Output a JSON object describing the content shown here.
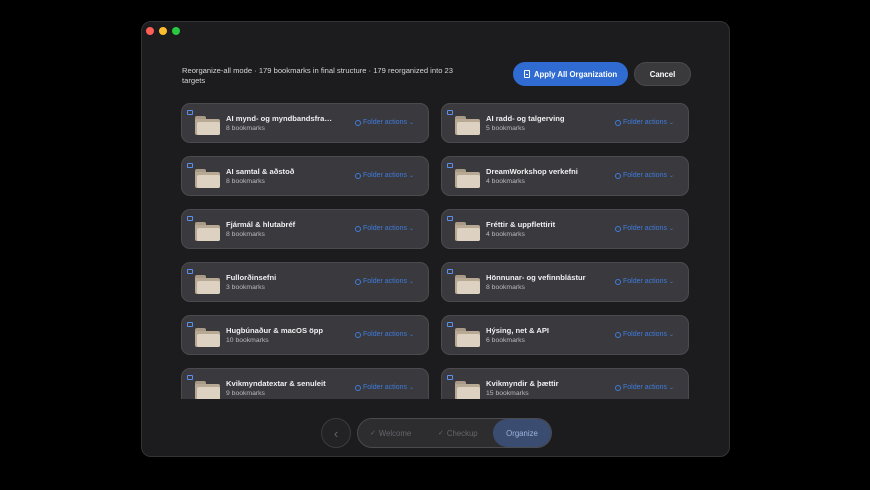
{
  "window": {
    "summary": "Reorganize-all mode · 179 bookmarks in final structure · 179 reorganized into 23 targets",
    "apply_label": "Apply All Organization",
    "cancel_label": "Cancel",
    "accent_color": "#2f6bd1"
  },
  "folders": [
    {
      "title": "AI mynd- og myndbandsframleið…",
      "count": "8 bookmarks",
      "actions": "Folder actions"
    },
    {
      "title": "AI radd- og talgerving",
      "count": "5 bookmarks",
      "actions": "Folder actions"
    },
    {
      "title": "AI samtal & aðstoð",
      "count": "8 bookmarks",
      "actions": "Folder actions"
    },
    {
      "title": "DreamWorkshop verkefni",
      "count": "4 bookmarks",
      "actions": "Folder actions"
    },
    {
      "title": "Fjármál & hlutabréf",
      "count": "8 bookmarks",
      "actions": "Folder actions"
    },
    {
      "title": "Fréttir & uppflettirit",
      "count": "4 bookmarks",
      "actions": "Folder actions"
    },
    {
      "title": "Fullorðinsefni",
      "count": "3 bookmarks",
      "actions": "Folder actions"
    },
    {
      "title": "Hönnunar- og vefinnblástur",
      "count": "8 bookmarks",
      "actions": "Folder actions"
    },
    {
      "title": "Hugbúnaður & macOS öpp",
      "count": "10 bookmarks",
      "actions": "Folder actions"
    },
    {
      "title": "Hýsing, net & API",
      "count": "6 bookmarks",
      "actions": "Folder actions"
    },
    {
      "title": "Kvikmyndatextar & senuleit",
      "count": "9 bookmarks",
      "actions": "Folder actions"
    },
    {
      "title": "Kvikmyndir & þættir",
      "count": "15 bookmarks",
      "actions": "Folder actions"
    }
  ],
  "steps": [
    {
      "label": "Welcome",
      "done": true
    },
    {
      "label": "Checkup",
      "done": true
    },
    {
      "label": "Organize",
      "active": true
    }
  ],
  "icons": {
    "back": "chevron-left-icon",
    "check": "✓",
    "folder": "folder-icon",
    "actions": "circle-ellipsis-icon",
    "apply": "document-icon"
  }
}
